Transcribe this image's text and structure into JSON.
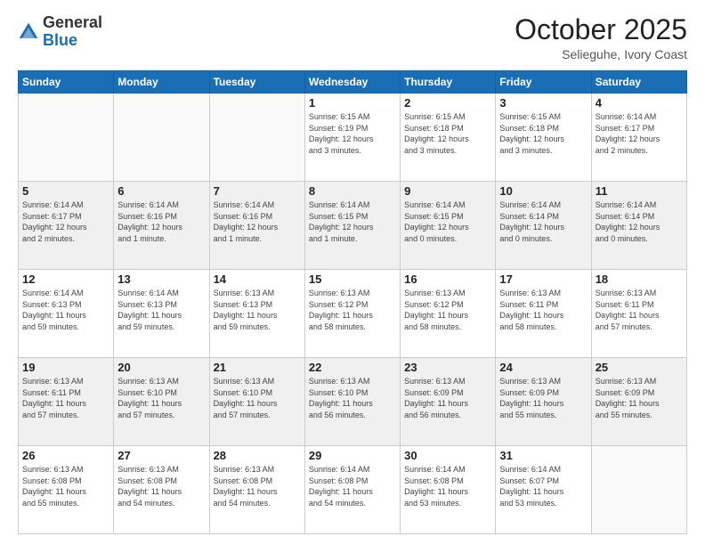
{
  "header": {
    "logo_general": "General",
    "logo_blue": "Blue",
    "month": "October 2025",
    "location": "Selieguhe, Ivory Coast"
  },
  "days_of_week": [
    "Sunday",
    "Monday",
    "Tuesday",
    "Wednesday",
    "Thursday",
    "Friday",
    "Saturday"
  ],
  "weeks": [
    [
      {
        "day": "",
        "info": ""
      },
      {
        "day": "",
        "info": ""
      },
      {
        "day": "",
        "info": ""
      },
      {
        "day": "1",
        "info": "Sunrise: 6:15 AM\nSunset: 6:19 PM\nDaylight: 12 hours\nand 3 minutes."
      },
      {
        "day": "2",
        "info": "Sunrise: 6:15 AM\nSunset: 6:18 PM\nDaylight: 12 hours\nand 3 minutes."
      },
      {
        "day": "3",
        "info": "Sunrise: 6:15 AM\nSunset: 6:18 PM\nDaylight: 12 hours\nand 3 minutes."
      },
      {
        "day": "4",
        "info": "Sunrise: 6:14 AM\nSunset: 6:17 PM\nDaylight: 12 hours\nand 2 minutes."
      }
    ],
    [
      {
        "day": "5",
        "info": "Sunrise: 6:14 AM\nSunset: 6:17 PM\nDaylight: 12 hours\nand 2 minutes."
      },
      {
        "day": "6",
        "info": "Sunrise: 6:14 AM\nSunset: 6:16 PM\nDaylight: 12 hours\nand 1 minute."
      },
      {
        "day": "7",
        "info": "Sunrise: 6:14 AM\nSunset: 6:16 PM\nDaylight: 12 hours\nand 1 minute."
      },
      {
        "day": "8",
        "info": "Sunrise: 6:14 AM\nSunset: 6:15 PM\nDaylight: 12 hours\nand 1 minute."
      },
      {
        "day": "9",
        "info": "Sunrise: 6:14 AM\nSunset: 6:15 PM\nDaylight: 12 hours\nand 0 minutes."
      },
      {
        "day": "10",
        "info": "Sunrise: 6:14 AM\nSunset: 6:14 PM\nDaylight: 12 hours\nand 0 minutes."
      },
      {
        "day": "11",
        "info": "Sunrise: 6:14 AM\nSunset: 6:14 PM\nDaylight: 12 hours\nand 0 minutes."
      }
    ],
    [
      {
        "day": "12",
        "info": "Sunrise: 6:14 AM\nSunset: 6:13 PM\nDaylight: 11 hours\nand 59 minutes."
      },
      {
        "day": "13",
        "info": "Sunrise: 6:14 AM\nSunset: 6:13 PM\nDaylight: 11 hours\nand 59 minutes."
      },
      {
        "day": "14",
        "info": "Sunrise: 6:13 AM\nSunset: 6:13 PM\nDaylight: 11 hours\nand 59 minutes."
      },
      {
        "day": "15",
        "info": "Sunrise: 6:13 AM\nSunset: 6:12 PM\nDaylight: 11 hours\nand 58 minutes."
      },
      {
        "day": "16",
        "info": "Sunrise: 6:13 AM\nSunset: 6:12 PM\nDaylight: 11 hours\nand 58 minutes."
      },
      {
        "day": "17",
        "info": "Sunrise: 6:13 AM\nSunset: 6:11 PM\nDaylight: 11 hours\nand 58 minutes."
      },
      {
        "day": "18",
        "info": "Sunrise: 6:13 AM\nSunset: 6:11 PM\nDaylight: 11 hours\nand 57 minutes."
      }
    ],
    [
      {
        "day": "19",
        "info": "Sunrise: 6:13 AM\nSunset: 6:11 PM\nDaylight: 11 hours\nand 57 minutes."
      },
      {
        "day": "20",
        "info": "Sunrise: 6:13 AM\nSunset: 6:10 PM\nDaylight: 11 hours\nand 57 minutes."
      },
      {
        "day": "21",
        "info": "Sunrise: 6:13 AM\nSunset: 6:10 PM\nDaylight: 11 hours\nand 57 minutes."
      },
      {
        "day": "22",
        "info": "Sunrise: 6:13 AM\nSunset: 6:10 PM\nDaylight: 11 hours\nand 56 minutes."
      },
      {
        "day": "23",
        "info": "Sunrise: 6:13 AM\nSunset: 6:09 PM\nDaylight: 11 hours\nand 56 minutes."
      },
      {
        "day": "24",
        "info": "Sunrise: 6:13 AM\nSunset: 6:09 PM\nDaylight: 11 hours\nand 55 minutes."
      },
      {
        "day": "25",
        "info": "Sunrise: 6:13 AM\nSunset: 6:09 PM\nDaylight: 11 hours\nand 55 minutes."
      }
    ],
    [
      {
        "day": "26",
        "info": "Sunrise: 6:13 AM\nSunset: 6:08 PM\nDaylight: 11 hours\nand 55 minutes."
      },
      {
        "day": "27",
        "info": "Sunrise: 6:13 AM\nSunset: 6:08 PM\nDaylight: 11 hours\nand 54 minutes."
      },
      {
        "day": "28",
        "info": "Sunrise: 6:13 AM\nSunset: 6:08 PM\nDaylight: 11 hours\nand 54 minutes."
      },
      {
        "day": "29",
        "info": "Sunrise: 6:14 AM\nSunset: 6:08 PM\nDaylight: 11 hours\nand 54 minutes."
      },
      {
        "day": "30",
        "info": "Sunrise: 6:14 AM\nSunset: 6:08 PM\nDaylight: 11 hours\nand 53 minutes."
      },
      {
        "day": "31",
        "info": "Sunrise: 6:14 AM\nSunset: 6:07 PM\nDaylight: 11 hours\nand 53 minutes."
      },
      {
        "day": "",
        "info": ""
      }
    ]
  ]
}
